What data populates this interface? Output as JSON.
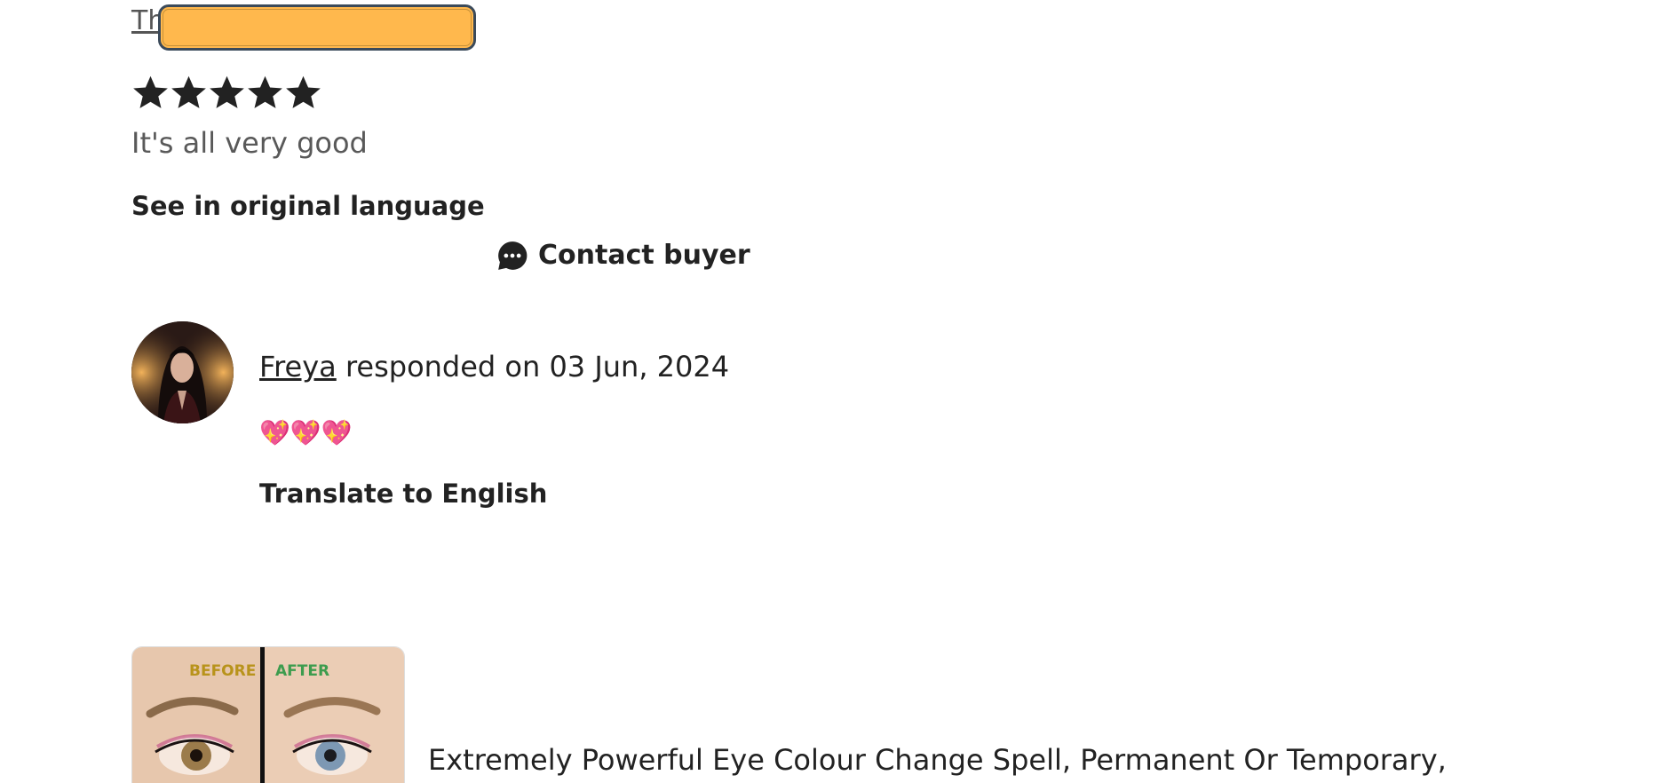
{
  "review": {
    "reviewer_partial": "Th",
    "rating": 5,
    "text": "It's all very good",
    "see_original": "See in original language",
    "contact_buyer": "Contact buyer",
    "redaction_color": "#FFB84D"
  },
  "response": {
    "seller": "Freya",
    "responded_text": "responded on 03 Jun, 2024",
    "message": "💖💖💖",
    "translate": "Translate to English"
  },
  "listing": {
    "image_before_label": "BEFORE",
    "image_after_label": "AFTER",
    "title": "Extremely Powerful Eye Colour Change Spell, Permanent Or Temporary,"
  },
  "icons": {
    "star": "star-icon",
    "chat": "chat-bubble-icon"
  }
}
